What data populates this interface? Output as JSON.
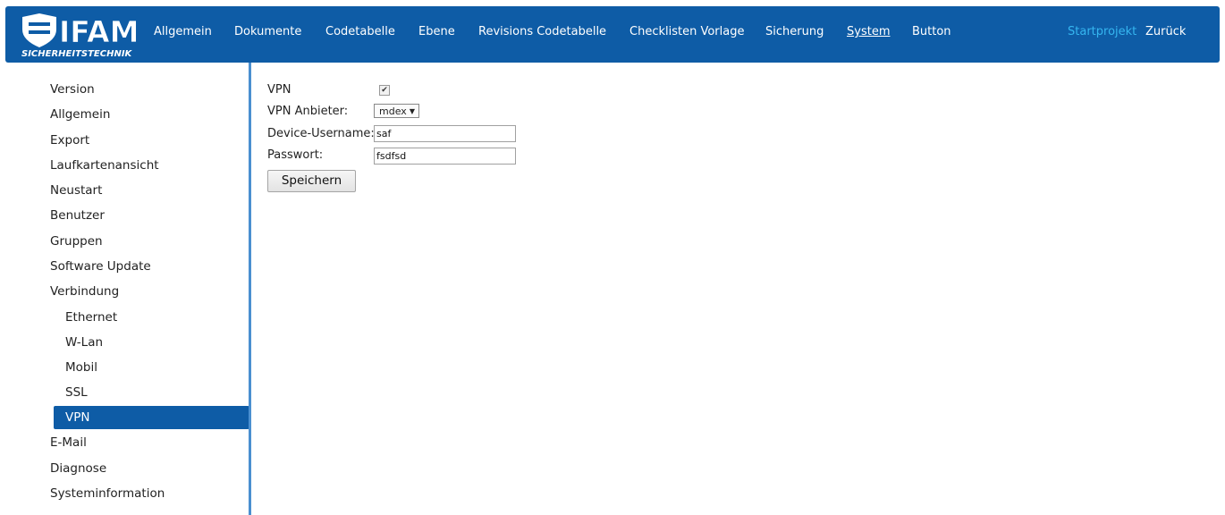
{
  "logo": {
    "main_text": "IFAM",
    "sub_text": "SICHERHEITSTECHNIK"
  },
  "nav": {
    "items": [
      "Allgemein",
      "Dokumente",
      "Codetabelle",
      "Ebene",
      "Revisions Codetabelle",
      "Checklisten Vorlage",
      "Sicherung",
      "System",
      "Button"
    ],
    "active": "System",
    "right": {
      "startprojekt": "Startprojekt",
      "zurueck": "Zurück"
    }
  },
  "colors": {
    "brand": "#0e5ca6",
    "accent": "#35b6f0",
    "divider": "#4a8fd0"
  },
  "sidebar": {
    "items": [
      "Version",
      "Allgemein",
      "Export",
      "Laufkartenansicht",
      "Neustart",
      "Benutzer",
      "Gruppen",
      "Software Update",
      "Verbindung"
    ],
    "sub_items": [
      "Ethernet",
      "W-Lan",
      "Mobil",
      "SSL",
      "VPN"
    ],
    "selected": "VPN",
    "tail_items": [
      "E-Mail",
      "Diagnose",
      "Systeminformation"
    ]
  },
  "form": {
    "vpn_label": "VPN",
    "vpn_checked": true,
    "provider_label": "VPN Anbieter:",
    "provider_value": "mdex",
    "username_label": "Device-Username:",
    "username_value": "saf",
    "password_label": "Passwort:",
    "password_value": "fsdfsd",
    "save_label": "Speichern"
  }
}
